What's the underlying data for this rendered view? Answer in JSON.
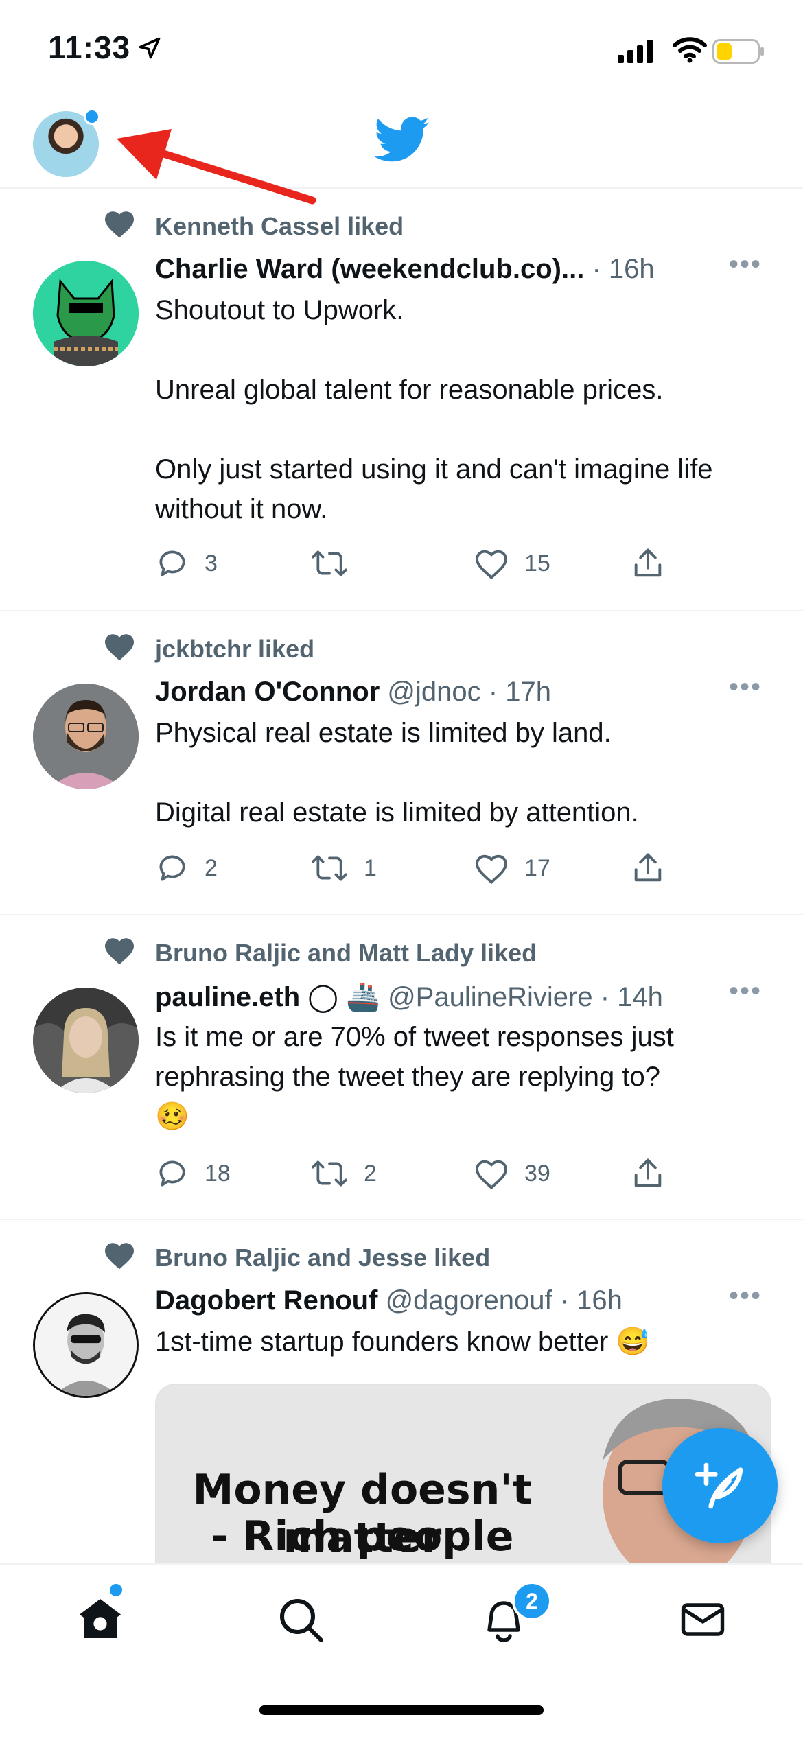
{
  "status_bar": {
    "time": "11:33"
  },
  "colors": {
    "accent": "#1d9bf0",
    "secondary_text": "#536471",
    "divider": "#eff3f4",
    "battery": "#ffd400"
  },
  "header": {
    "logo": "twitter-bird-icon"
  },
  "tweets": [
    {
      "liked_by": "Kenneth Cassel liked",
      "name": "Charlie Ward (weekendclub.co)...",
      "handle": "",
      "time": "· 16h",
      "text": "Shoutout to Upwork.\n\nUnreal global talent for reasonable prices.\n\nOnly just started using it and can't imagine life without it now.",
      "replies": "3",
      "retweets": "",
      "likes": "15"
    },
    {
      "liked_by": "jckbtchr liked",
      "name": "Jordan O'Connor",
      "handle": "@jdnoc",
      "time": "· 17h",
      "text": "Physical real estate is limited by land.\n\nDigital real estate is limited by attention.",
      "replies": "2",
      "retweets": "1",
      "likes": "17"
    },
    {
      "liked_by": "Bruno Raljic and Matt Lady liked",
      "name": "pauline.eth",
      "name_emoji": "◯ 🚢",
      "handle": "@PaulineRiviere",
      "time": "· 14h",
      "text": "Is it me or are 70% of tweet responses just rephrasing the tweet they are replying to?\n🥴",
      "replies": "18",
      "retweets": "2",
      "likes": "39"
    },
    {
      "liked_by": "Bruno Raljic and Jesse liked",
      "name": "Dagobert Renouf",
      "handle": "@dagorenouf",
      "time": "· 16h",
      "text": "1st-time startup founders know better 😅",
      "media_line1": "Money doesn't matter",
      "media_line2": "- Rich people"
    }
  ],
  "tabbar": {
    "notifications_badge": "2"
  }
}
